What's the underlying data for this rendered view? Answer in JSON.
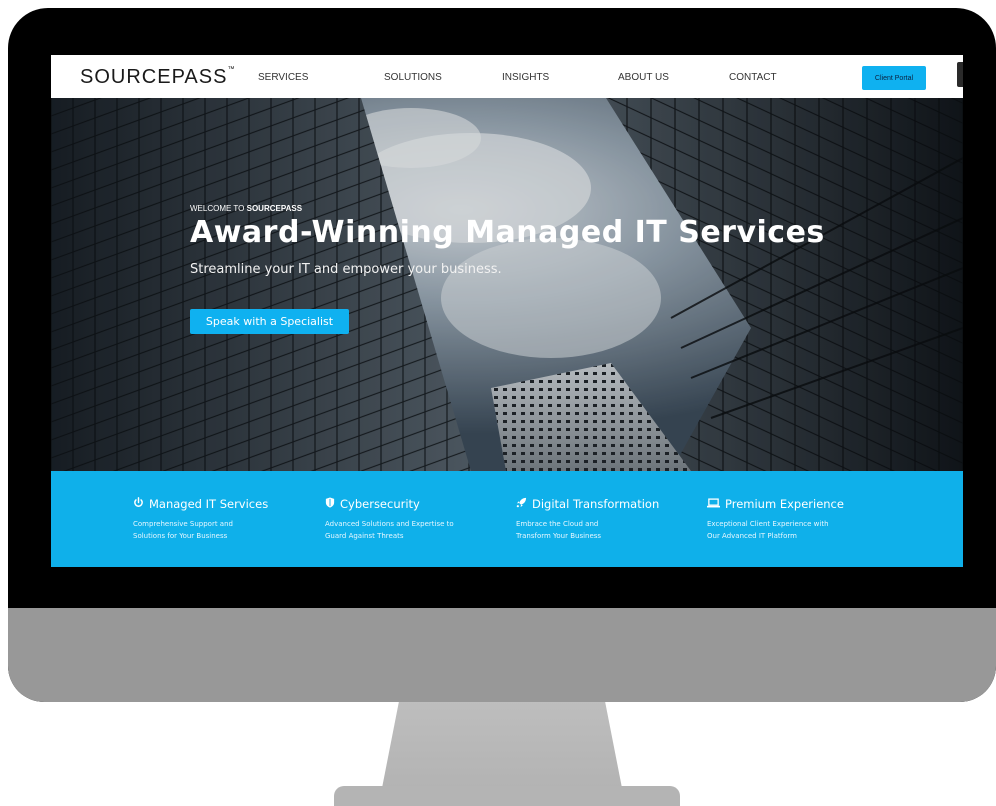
{
  "nav": {
    "logo": "SOURCEPASS",
    "logo_mark": "™",
    "items": [
      "SERVICES",
      "SOLUTIONS",
      "INSIGHTS",
      "ABOUT US",
      "CONTACT"
    ],
    "portal_button": "Client Portal"
  },
  "hero": {
    "welcome_prefix": "WELCOME TO ",
    "welcome_brand": "SOURCEPASS",
    "headline": "Award-Winning Managed IT Services",
    "subline": "Streamline your IT and empower your business.",
    "cta": "Speak with a Specialist"
  },
  "features": [
    {
      "icon": "power-icon",
      "title": "Managed IT Services",
      "desc_line1": "Comprehensive Support and",
      "desc_line2": "Solutions for Your Business"
    },
    {
      "icon": "shield-icon",
      "title": "Cybersecurity",
      "desc_line1": "Advanced Solutions and Expertise to",
      "desc_line2": "Guard Against Threats"
    },
    {
      "icon": "rocket-icon",
      "title": "Digital Transformation",
      "desc_line1": "Embrace the Cloud and",
      "desc_line2": "Transform Your Business"
    },
    {
      "icon": "laptop-icon",
      "title": "Premium Experience",
      "desc_line1": "Exceptional Client Experience with",
      "desc_line2": "Our Advanced IT Platform"
    }
  ],
  "colors": {
    "accent": "#0fb1f0",
    "band": "#0fb0ea",
    "monitor_bezel": "#000000",
    "monitor_chin": "#989898"
  }
}
